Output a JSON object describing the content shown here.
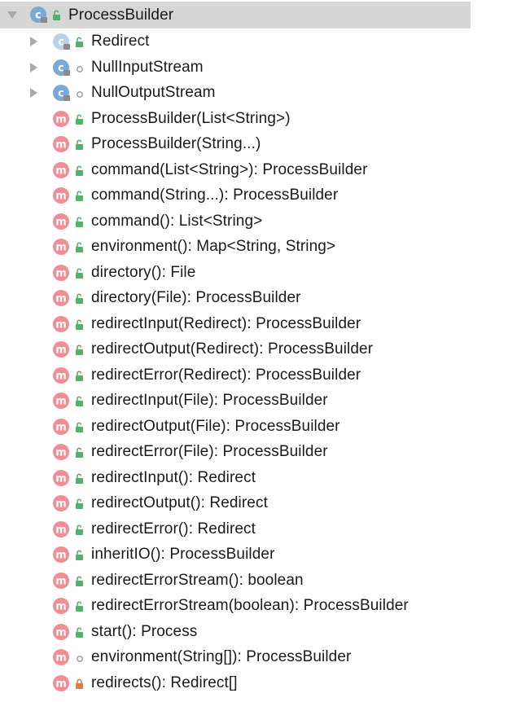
{
  "tree": {
    "root": {
      "label": "ProcessBuilder",
      "kind": "class",
      "visibility": "public",
      "expanded": true
    },
    "nested_classes": [
      {
        "label": "Redirect",
        "kind": "abstract-class",
        "visibility": "public",
        "expanded": false
      },
      {
        "label": "NullInputStream",
        "kind": "class",
        "visibility": "package-private",
        "expanded": false
      },
      {
        "label": "NullOutputStream",
        "kind": "class",
        "visibility": "package-private",
        "expanded": false
      }
    ],
    "methods": [
      {
        "label": "ProcessBuilder(List<String>)",
        "kind": "method",
        "visibility": "public"
      },
      {
        "label": "ProcessBuilder(String...)",
        "kind": "method",
        "visibility": "public"
      },
      {
        "label": "command(List<String>): ProcessBuilder",
        "kind": "method",
        "visibility": "public"
      },
      {
        "label": "command(String...): ProcessBuilder",
        "kind": "method",
        "visibility": "public"
      },
      {
        "label": "command(): List<String>",
        "kind": "method",
        "visibility": "public"
      },
      {
        "label": "environment(): Map<String, String>",
        "kind": "method",
        "visibility": "public"
      },
      {
        "label": "directory(): File",
        "kind": "method",
        "visibility": "public"
      },
      {
        "label": "directory(File): ProcessBuilder",
        "kind": "method",
        "visibility": "public"
      },
      {
        "label": "redirectInput(Redirect): ProcessBuilder",
        "kind": "method",
        "visibility": "public"
      },
      {
        "label": "redirectOutput(Redirect): ProcessBuilder",
        "kind": "method",
        "visibility": "public"
      },
      {
        "label": "redirectError(Redirect): ProcessBuilder",
        "kind": "method",
        "visibility": "public"
      },
      {
        "label": "redirectInput(File): ProcessBuilder",
        "kind": "method",
        "visibility": "public"
      },
      {
        "label": "redirectOutput(File): ProcessBuilder",
        "kind": "method",
        "visibility": "public"
      },
      {
        "label": "redirectError(File): ProcessBuilder",
        "kind": "method",
        "visibility": "public"
      },
      {
        "label": "redirectInput(): Redirect",
        "kind": "method",
        "visibility": "public"
      },
      {
        "label": "redirectOutput(): Redirect",
        "kind": "method",
        "visibility": "public"
      },
      {
        "label": "redirectError(): Redirect",
        "kind": "method",
        "visibility": "public"
      },
      {
        "label": "inheritIO(): ProcessBuilder",
        "kind": "method",
        "visibility": "public"
      },
      {
        "label": "redirectErrorStream(): boolean",
        "kind": "method",
        "visibility": "public"
      },
      {
        "label": "redirectErrorStream(boolean): ProcessBuilder",
        "kind": "method",
        "visibility": "public"
      },
      {
        "label": "start(): Process",
        "kind": "method",
        "visibility": "public"
      },
      {
        "label": "environment(String[]): ProcessBuilder",
        "kind": "method",
        "visibility": "package-private"
      },
      {
        "label": "redirects(): Redirect[]",
        "kind": "method",
        "visibility": "private"
      }
    ]
  },
  "icons": {
    "class": "class-icon",
    "abstract-class": "abstract-class-icon",
    "method": "method-icon",
    "public": "public-lock-icon",
    "package-private": "package-private-icon",
    "private": "private-lock-icon",
    "expanded": "chevron-down-icon",
    "collapsed": "chevron-right-icon"
  },
  "colors": {
    "selection_bg": "#d6d6d6",
    "class_blue": "#7aa9d6",
    "method_pink": "#f28d96",
    "public_green": "#52b16a",
    "private_orange": "#e57a42",
    "arrow_gray": "#a9a9a9",
    "text": "#1a1a1a"
  }
}
